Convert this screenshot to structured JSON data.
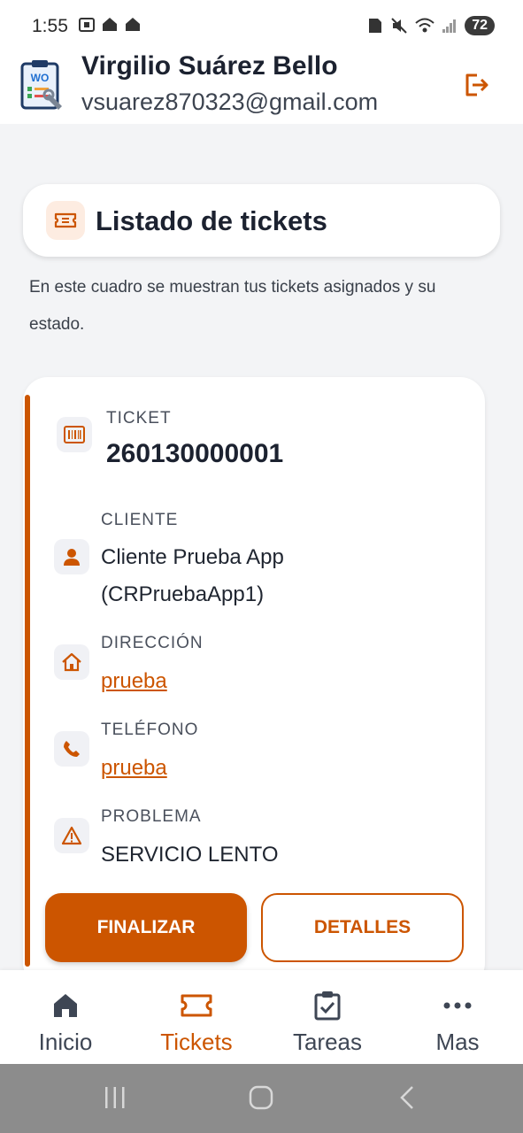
{
  "status_bar": {
    "time": "1:55",
    "battery": "72"
  },
  "header": {
    "user_name": "Virgilio Suárez Bello",
    "user_email": "vsuarez870323@gmail.com",
    "logo_text": "WO"
  },
  "page": {
    "title": "Listado de tickets",
    "intro": "En este cuadro se muestran tus tickets asignados y su estado."
  },
  "ticket": {
    "ticket_label": "TICKET",
    "ticket_number": "260130000001",
    "client_label": "CLIENTE",
    "client_value": "Cliente Prueba App (CRPruebaApp1)",
    "address_label": "DIRECCIÓN",
    "address_value": "prueba",
    "phone_label": "TELÉFONO",
    "phone_value": "prueba",
    "problem_label": "PROBLEMA",
    "problem_value": "SERVICIO LENTO",
    "finalize_label": "FINALIZAR",
    "details_label": "DETALLES"
  },
  "nav": {
    "items": [
      {
        "label": "Inicio",
        "icon": "home-icon"
      },
      {
        "label": "Tickets",
        "icon": "ticket-icon",
        "active": true
      },
      {
        "label": "Tareas",
        "icon": "clipboard-check-icon"
      },
      {
        "label": "Mas",
        "icon": "more-dots-icon"
      }
    ]
  },
  "colors": {
    "accent": "#cc5500",
    "background": "#f3f4f6",
    "text": "#1c2230"
  }
}
